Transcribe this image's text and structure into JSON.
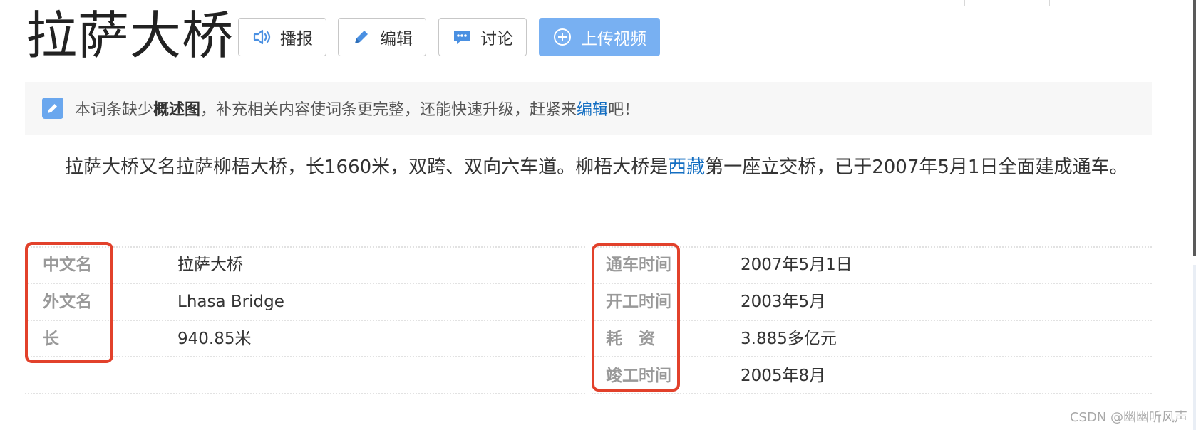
{
  "title": "拉萨大桥",
  "actions": {
    "play_label": "播报",
    "edit_label": "编辑",
    "discuss_label": "讨论",
    "upload_label": "上传视频"
  },
  "notice": {
    "prefix": "本词条缺少",
    "bold": "概述图",
    "middle": "，补充相关内容使词条更完整，还能快速升级，赶紧来",
    "link": "编辑",
    "suffix": "吧！"
  },
  "summary": {
    "part1": "拉萨大桥又名拉萨柳梧大桥，长1660米，双跨、双向六车道。柳梧大桥是",
    "link": "西藏",
    "part2": "第一座立交桥，已于2007年5月1日全面建成通车。"
  },
  "info_left": [
    {
      "label": "中文名",
      "value": "拉萨大桥"
    },
    {
      "label": "外文名",
      "value": "Lhasa Bridge"
    },
    {
      "label": "长",
      "value": "940.85米"
    }
  ],
  "info_right": [
    {
      "label": "通车时间",
      "value": "2007年5月1日"
    },
    {
      "label": "开工时间",
      "value": "2003年5月"
    },
    {
      "label": "耗　资",
      "value": "3.885多亿元"
    },
    {
      "label": "竣工时间",
      "value": "2005年8月"
    }
  ],
  "watermark": "CSDN @幽幽听风声",
  "colors": {
    "accent_blue": "#78b0f2",
    "link_blue": "#136ec2",
    "highlight_red": "#e2412b"
  },
  "icons": {
    "play": "speaker-icon",
    "edit": "pencil-icon",
    "discuss": "chat-bubble-icon",
    "upload": "plus-circle-icon",
    "notice": "pencil-icon"
  }
}
